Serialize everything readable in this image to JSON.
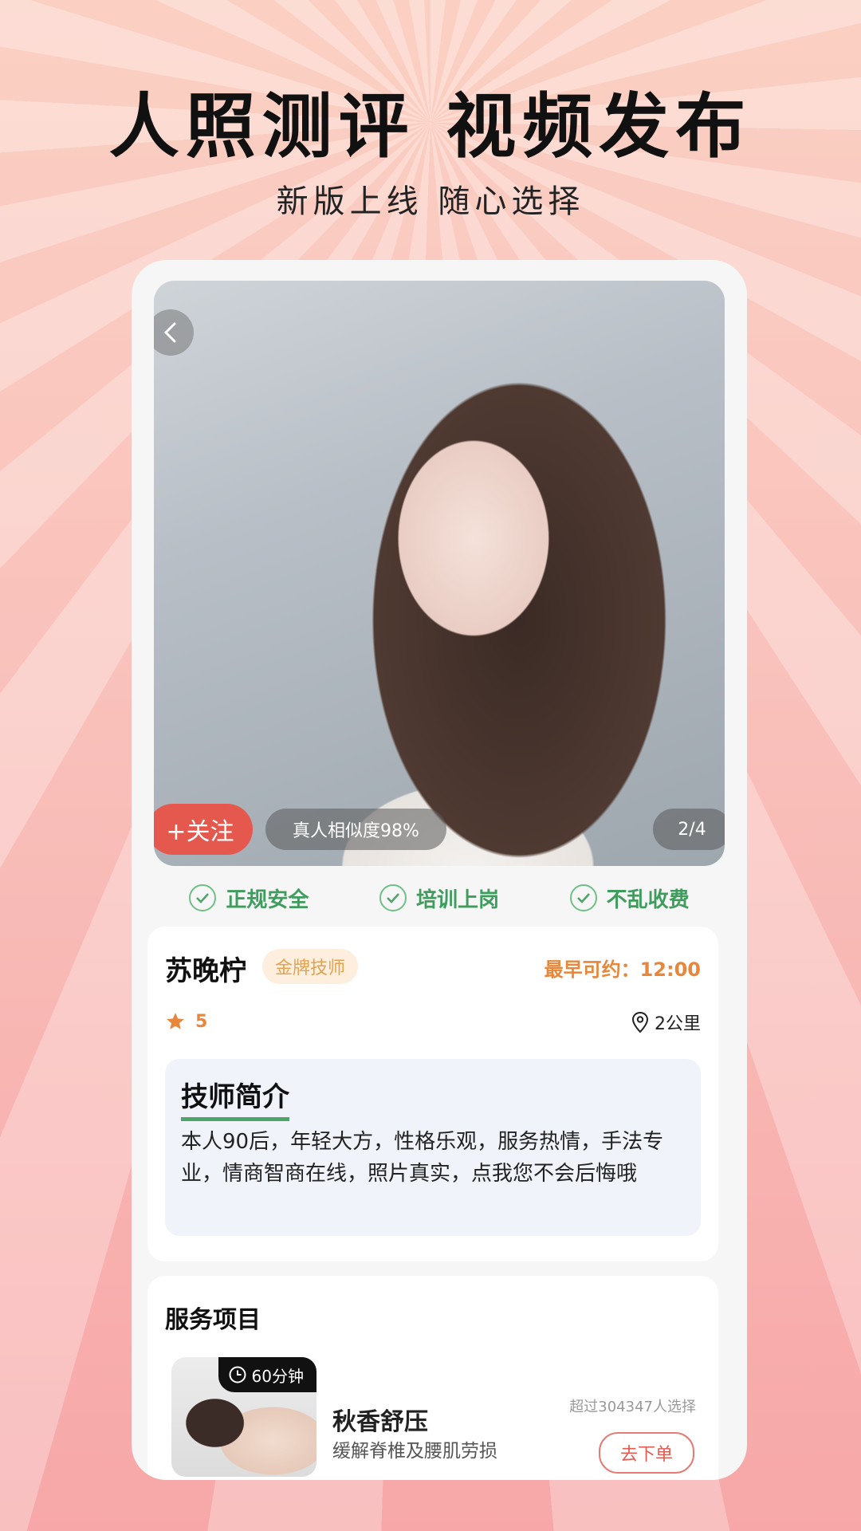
{
  "banner": {
    "headline": "人照测评 视频发布",
    "subline": "新版上线 随心选择"
  },
  "photo": {
    "follow_label": "+关注",
    "similarity_label": "真人相似度98%",
    "page_indicator": "2/4"
  },
  "badges": [
    {
      "label": "正规安全"
    },
    {
      "label": "培训上岗"
    },
    {
      "label": "不乱收费"
    }
  ],
  "technician": {
    "name": "苏晚柠",
    "badge": "金牌技师",
    "earliest_label": "最早可约：12:00",
    "rating": "5",
    "distance": "2公里",
    "intro_title": "技师简介",
    "intro_text": "本人90后，年轻大方，性格乐观，服务热情，手法专业，情商智商在线，照片真实，点我您不会后悔哦"
  },
  "service": {
    "section_title": "服务项目",
    "duration": "60分钟",
    "name": "秋香舒压",
    "desc": "缓解脊椎及腰肌劳损",
    "count": "超过304347人选择",
    "order_label": "去下单"
  },
  "colors": {
    "accent_green": "#3e9d5d",
    "accent_orange": "#e6873b",
    "follow_red": "#e5584e"
  }
}
